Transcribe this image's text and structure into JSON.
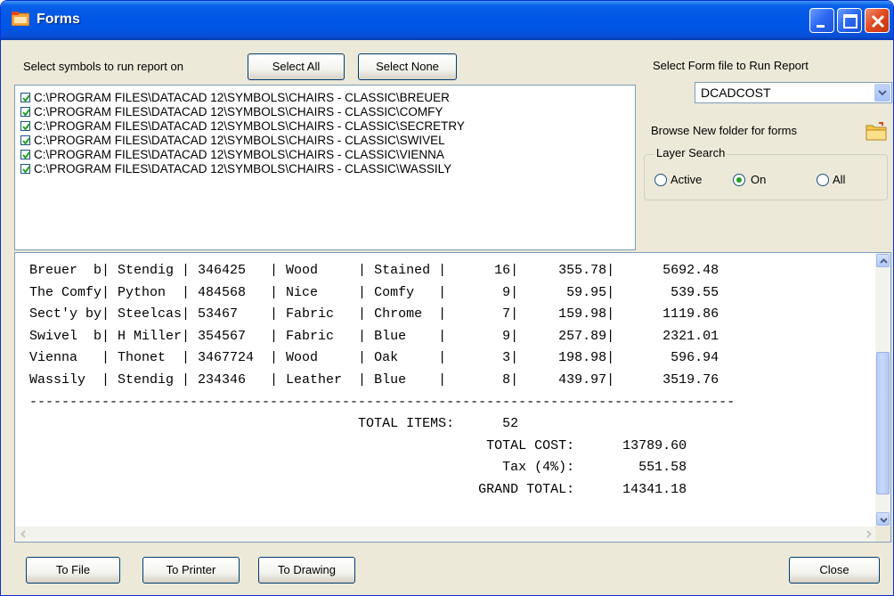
{
  "window": {
    "title": "Forms"
  },
  "top": {
    "select_symbols_label": "Select symbols to run report on",
    "select_all": "Select All",
    "select_none": "Select None"
  },
  "symbols": [
    {
      "checked": true,
      "path": "C:\\PROGRAM FILES\\DATACAD 12\\SYMBOLS\\CHAIRS - CLASSIC\\BREUER"
    },
    {
      "checked": true,
      "path": "C:\\PROGRAM FILES\\DATACAD 12\\SYMBOLS\\CHAIRS - CLASSIC\\COMFY"
    },
    {
      "checked": true,
      "path": "C:\\PROGRAM FILES\\DATACAD 12\\SYMBOLS\\CHAIRS - CLASSIC\\SECRETRY"
    },
    {
      "checked": true,
      "path": "C:\\PROGRAM FILES\\DATACAD 12\\SYMBOLS\\CHAIRS - CLASSIC\\SWIVEL"
    },
    {
      "checked": true,
      "path": "C:\\PROGRAM FILES\\DATACAD 12\\SYMBOLS\\CHAIRS - CLASSIC\\VIENNA"
    },
    {
      "checked": true,
      "path": "C:\\PROGRAM FILES\\DATACAD 12\\SYMBOLS\\CHAIRS - CLASSIC\\WASSILY"
    }
  ],
  "right_panel": {
    "form_file_label": "Select Form file to Run Report",
    "form_file_value": "DCADCOST",
    "browse_label": "Browse New folder for forms",
    "layer_search": {
      "title": "Layer Search",
      "options": [
        "Active",
        "On",
        "All"
      ],
      "selected": "On"
    }
  },
  "report_lines": [
    "Breuer  b| Stendig | 346425   | Wood     | Stained |      16|     355.78|      5692.48",
    "The Comfy| Python  | 484568   | Nice     | Comfy   |       9|      59.95|       539.55",
    "Sect'y by| Steelcas| 53467    | Fabric   | Chrome  |       7|     159.98|      1119.86",
    "Swivel  b| H Miller| 354567   | Fabric   | Blue    |       9|     257.89|      2321.01",
    "Vienna   | Thonet  | 3467724  | Wood     | Oak     |       3|     198.98|       596.94",
    "Wassily  | Stendig | 234346   | Leather  | Blue    |       8|     439.97|      3519.76",
    "----------------------------------------------------------------------------------------",
    "                                         TOTAL ITEMS:      52",
    "                                                         TOTAL COST:      13789.60",
    "                                                           Tax (4%):        551.58",
    "                                                        GRAND TOTAL:      14341.18"
  ],
  "bottom": {
    "to_file": "To File",
    "to_printer": "To Printer",
    "to_drawing": "To Drawing",
    "close": "Close"
  }
}
